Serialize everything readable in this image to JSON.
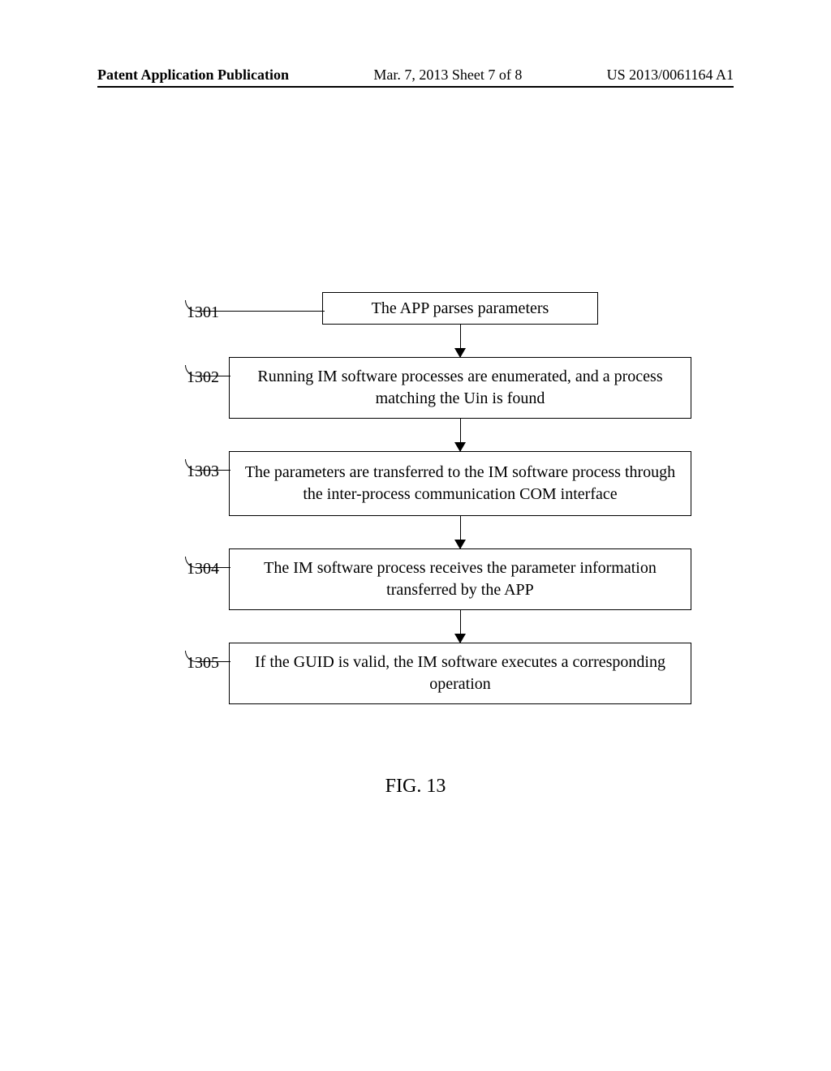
{
  "header": {
    "left": "Patent Application Publication",
    "center": "Mar. 7, 2013  Sheet 7 of 8",
    "right": "US 2013/0061164 A1"
  },
  "flowchart": {
    "steps": [
      {
        "num": "1301",
        "text": "The APP parses parameters"
      },
      {
        "num": "1302",
        "text": "Running IM software processes are enumerated, and a process matching the Uin is found"
      },
      {
        "num": "1303",
        "text": "The parameters are transferred to the IM software process through the inter-process communication COM interface"
      },
      {
        "num": "1304",
        "text": "The IM software process receives the parameter information transferred by the APP"
      },
      {
        "num": "1305",
        "text": "If the GUID is valid, the IM software executes a corresponding operation"
      }
    ]
  },
  "caption": "FIG. 13"
}
